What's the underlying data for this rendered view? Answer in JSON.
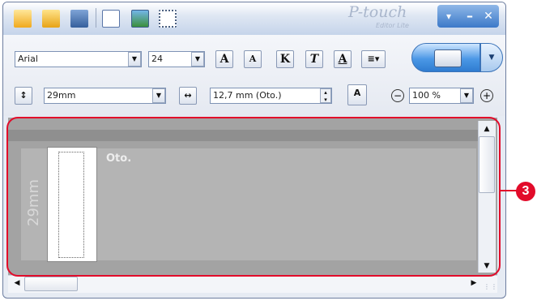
{
  "title_bar": {
    "brand_name": "P-touch",
    "brand_sub": "Editor Lite",
    "minimize_symbol": "–",
    "close_symbol": "✕",
    "menu_symbol": "▾"
  },
  "font_row": {
    "font_name": "Arial",
    "font_size": "24",
    "bigger_label": "A",
    "smaller_label": "A",
    "bold_label": "K",
    "italic_label": "T",
    "underline_label": "A",
    "dropdown_symbol": "▼"
  },
  "tape_row": {
    "tape_width": "29mm",
    "label_length": "12,7 mm (Oto.)",
    "zoom": "100 %",
    "zoom_out_symbol": "−",
    "zoom_in_symbol": "+"
  },
  "editor": {
    "tape_width_label": "29mm",
    "length_label": "Oto."
  },
  "callout": {
    "number": "3"
  },
  "colors": {
    "callout": "#e20b2a",
    "accent_blue": "#4b98e6"
  }
}
